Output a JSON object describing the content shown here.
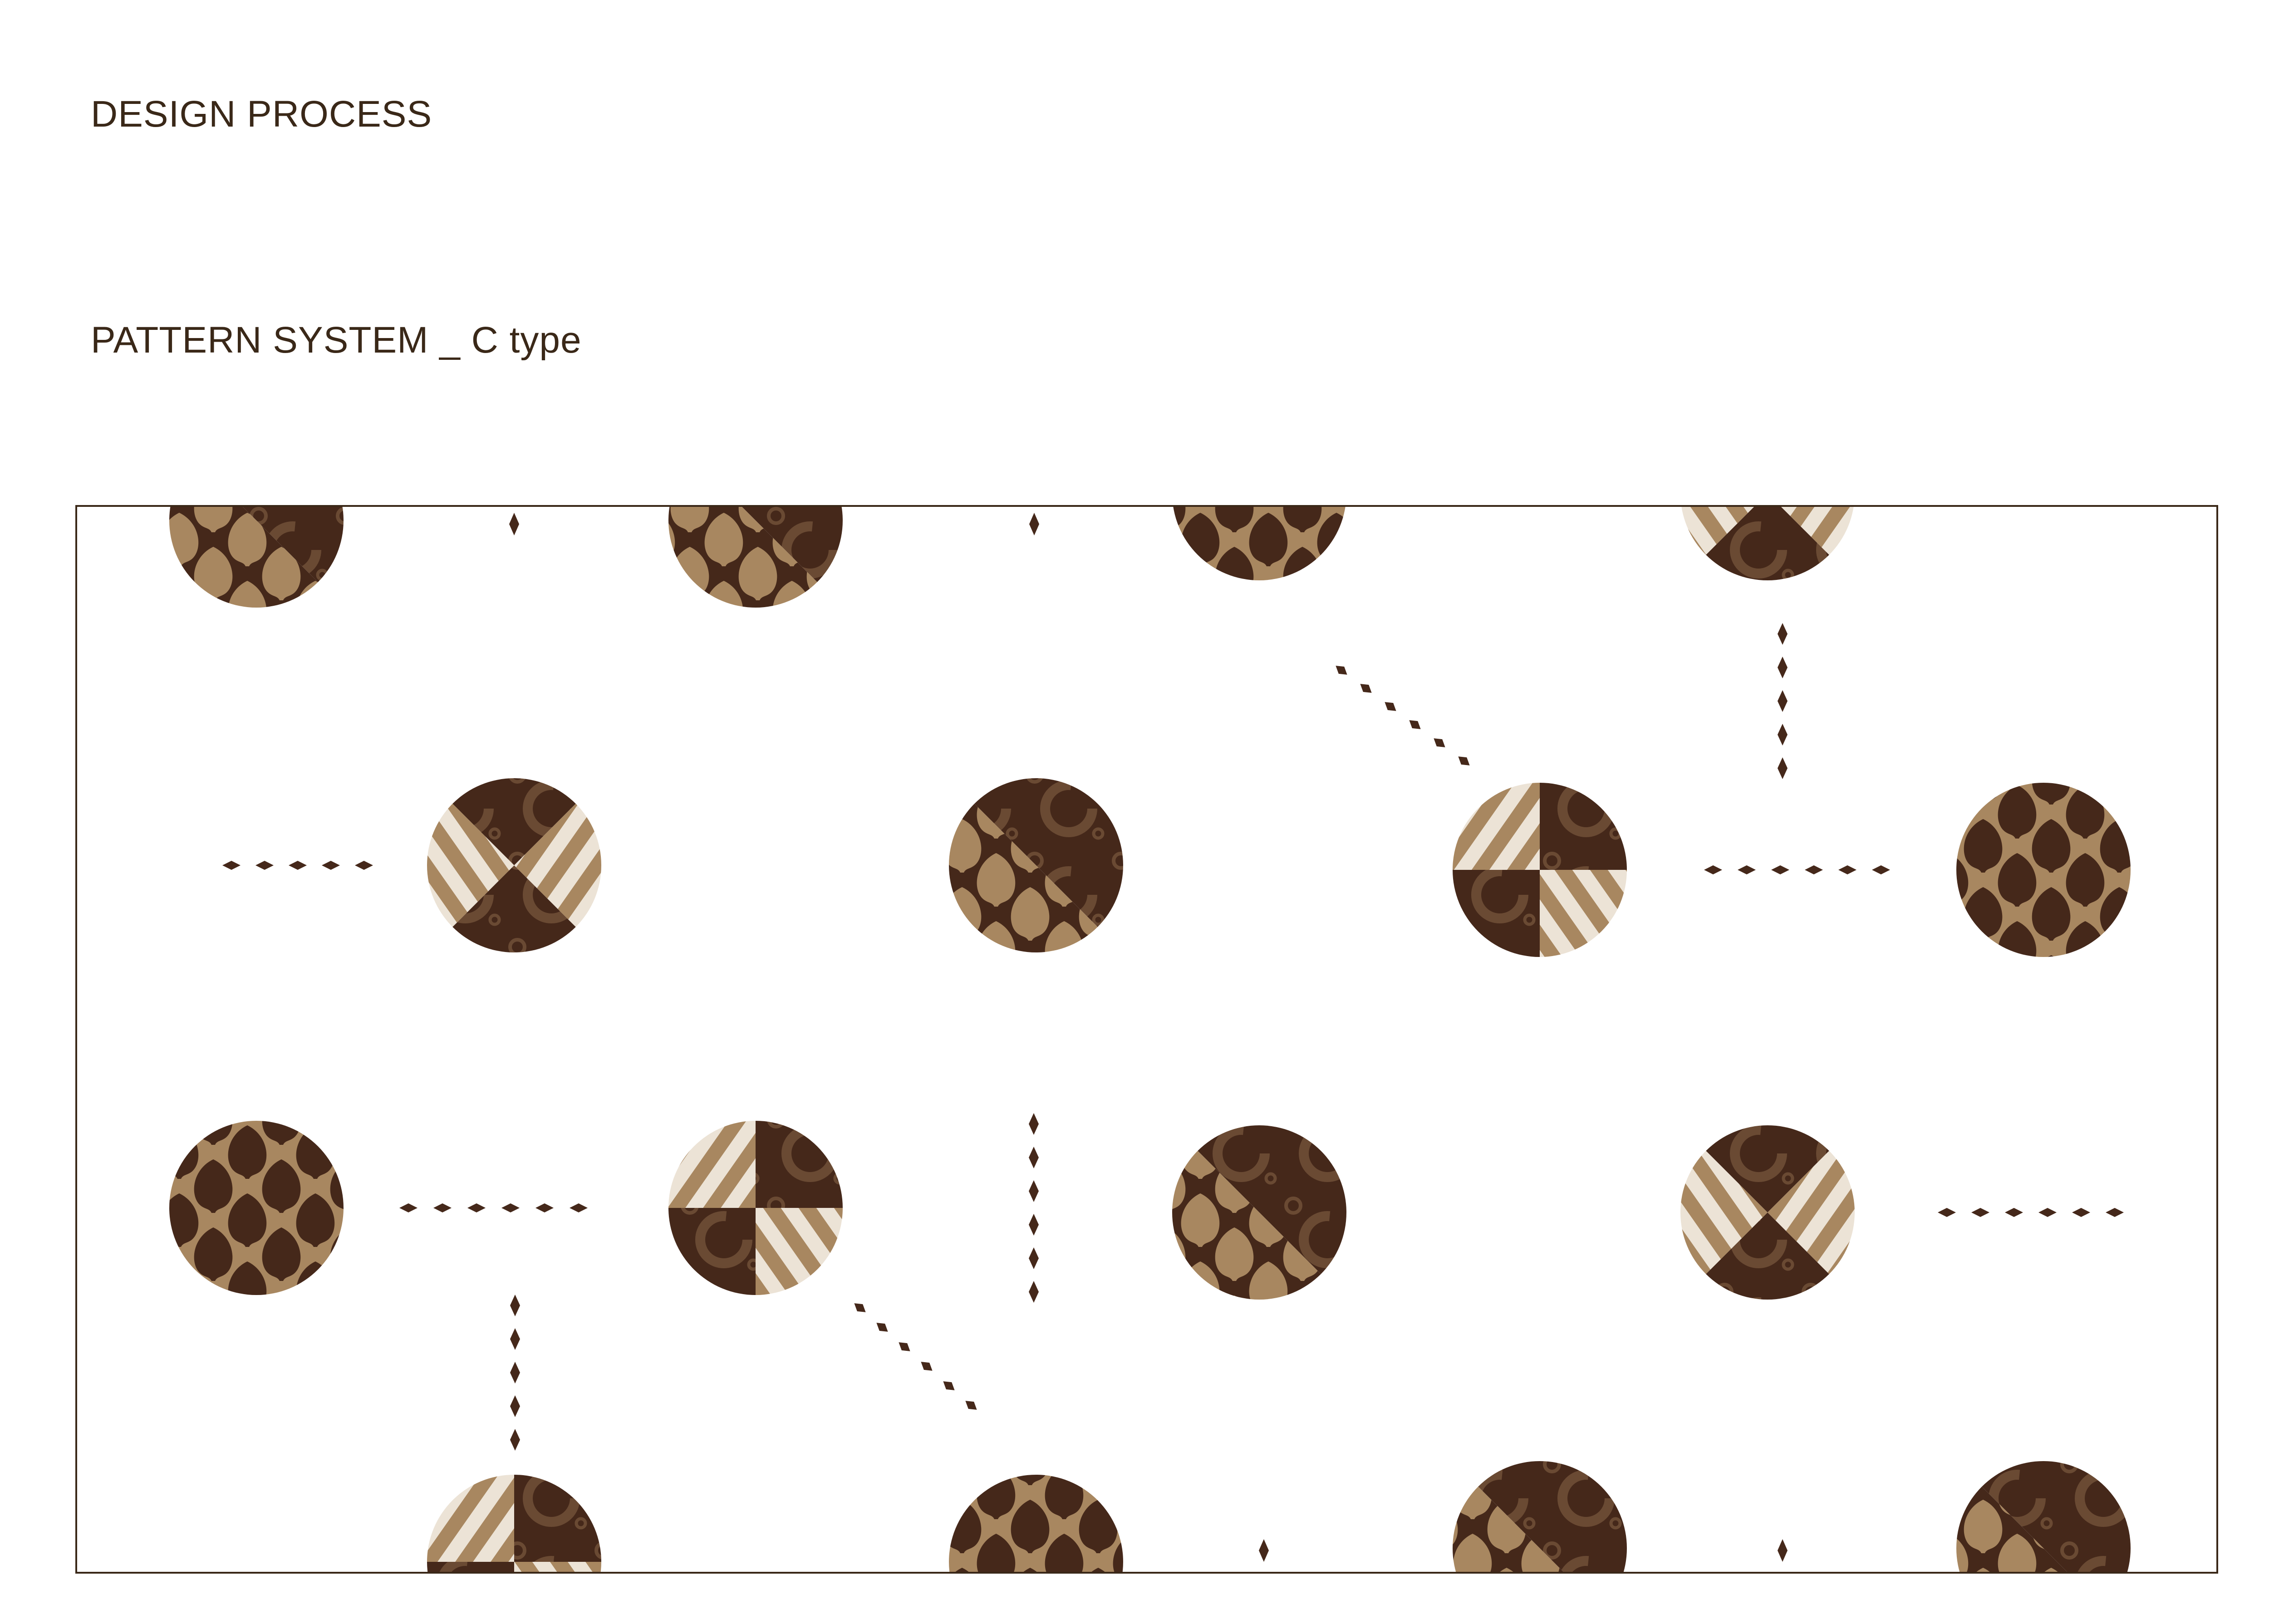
{
  "header": {
    "section_title": "DESIGN PROCESS",
    "subtitle": "PATTERN SYSTEM _ C type"
  },
  "colors": {
    "dark_brown": "#45281a",
    "tan": "#a88760",
    "cream": "#ece3d6",
    "mid_brown": "#6a4a33",
    "text": "#3a2818",
    "frame": "#3a2818"
  },
  "pattern_types": [
    "bulb",
    "split-bulb",
    "bowtie-stripe",
    "quarter-mix"
  ]
}
